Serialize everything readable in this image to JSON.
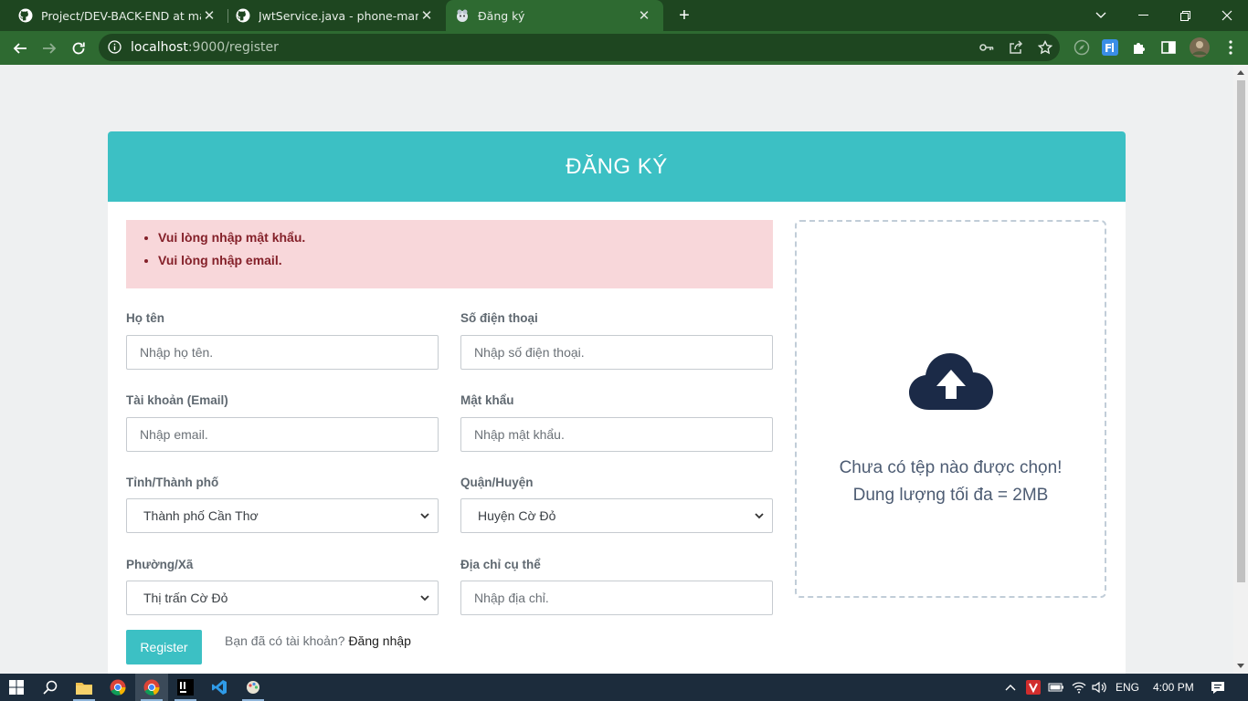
{
  "browser": {
    "tabs": [
      {
        "title": "Project/DEV-BACK-END at main ·",
        "icon": "github-icon"
      },
      {
        "title": "JwtService.java - phone-manager",
        "icon": "github-icon"
      },
      {
        "title": "Đăng ký",
        "icon": "site-favicon-icon",
        "active": true
      }
    ],
    "url_host": "localhost",
    "url_rest": ":9000/register"
  },
  "page": {
    "title": "ĐĂNG KÝ",
    "errors": [
      "Vui lòng nhập mật khẩu.",
      "Vui lòng nhập email."
    ],
    "fields": {
      "fullname": {
        "label": "Họ tên",
        "placeholder": "Nhập họ tên."
      },
      "phone": {
        "label": "Số điện thoại",
        "placeholder": "Nhập số điện thoại."
      },
      "email": {
        "label": "Tài khoản (Email)",
        "placeholder": "Nhập email."
      },
      "password": {
        "label": "Mật khẩu",
        "placeholder": "Nhập mật khẩu."
      },
      "city": {
        "label": "Tỉnh/Thành phố",
        "value": "Thành phố Cần Thơ"
      },
      "district": {
        "label": "Quận/Huyện",
        "value": "Huyện Cờ Đỏ"
      },
      "ward": {
        "label": "Phường/Xã",
        "value": "Thị trấn Cờ Đỏ"
      },
      "address": {
        "label": "Địa chỉ cụ thể",
        "placeholder": "Nhập địa chỉ."
      }
    },
    "register_button": "Register",
    "login_prompt": "Bạn đã có tài khoản?",
    "login_link": "Đăng nhập",
    "upload": {
      "line1": "Chưa có tệp nào được chọn!",
      "line2": "Dung lượng tối đa = 2MB"
    }
  },
  "taskbar": {
    "language": "ENG",
    "time": "4:00 PM"
  },
  "colors": {
    "accent": "#3cc0c4",
    "chrome_dark": "#1e4620",
    "chrome_light": "#2e6a31",
    "alert_bg": "#f8d7da",
    "alert_text": "#842029",
    "upload_icon": "#1b2a47"
  }
}
